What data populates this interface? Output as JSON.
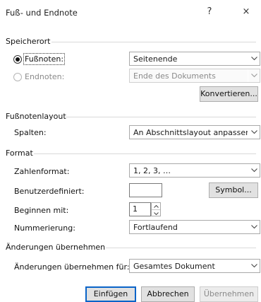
{
  "window": {
    "title": "Fuß- und Endnote",
    "help_label": "?",
    "close_label": "×"
  },
  "location": {
    "section_title": "Speicherort",
    "footnotes_label": "Fußnoten:",
    "footnotes_value": "Seitenende",
    "endnotes_label": "Endnoten:",
    "endnotes_value": "Ende des Dokuments",
    "convert_label": "Konvertieren..."
  },
  "layout": {
    "section_title": "Fußnotenlayout",
    "columns_label": "Spalten:",
    "columns_value": "An Abschnittslayout anpassen"
  },
  "format": {
    "section_title": "Format",
    "number_format_label": "Zahlenformat:",
    "number_format_value": "1, 2, 3, …",
    "custom_label": "Benutzerdefiniert:",
    "custom_value": "",
    "symbol_label": "Symbol...",
    "start_label": "Beginnen mit:",
    "start_value": "1",
    "numbering_label": "Nummerierung:",
    "numbering_value": "Fortlaufend"
  },
  "apply": {
    "section_title": "Änderungen übernehmen",
    "apply_label": "Änderungen übernehmen für:",
    "apply_value": "Gesamtes Dokument"
  },
  "buttons": {
    "insert": "Einfügen",
    "cancel": "Abbrechen",
    "apply": "Übernehmen"
  },
  "colors": {
    "primary_border": "#0a64c8",
    "disabled_text": "#8a8a8a"
  }
}
